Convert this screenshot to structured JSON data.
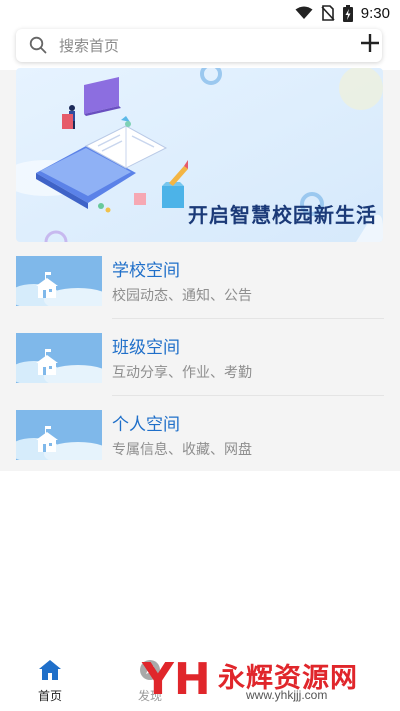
{
  "status_bar": {
    "time": "9:30",
    "icons": [
      "wifi-icon",
      "no-sim-icon",
      "battery-charging-icon"
    ]
  },
  "search": {
    "placeholder": "搜索首页",
    "icon": "search-icon",
    "add_icon": "plus-icon"
  },
  "banner": {
    "headline": "开启智慧校园新生活"
  },
  "spaces": [
    {
      "title": "学校空间",
      "desc": "校园动态、通知、公告"
    },
    {
      "title": "班级空间",
      "desc": "互动分享、作业、考勤"
    },
    {
      "title": "个人空间",
      "desc": "专属信息、收藏、网盘"
    }
  ],
  "bottom_nav": {
    "tabs": [
      {
        "label": "首页",
        "icon": "home-icon",
        "active": true
      },
      {
        "label": "发现",
        "icon": "discover-icon",
        "active": false
      }
    ]
  },
  "watermark": {
    "logo_letters": "YH",
    "name": "永辉资源网",
    "url": "www.yhkjjj.com"
  },
  "colors": {
    "accent": "#1f6fc9",
    "muted_text": "#8e8e8e",
    "content_bg": "#f4f4f4",
    "watermark_red": "#e0262b"
  }
}
